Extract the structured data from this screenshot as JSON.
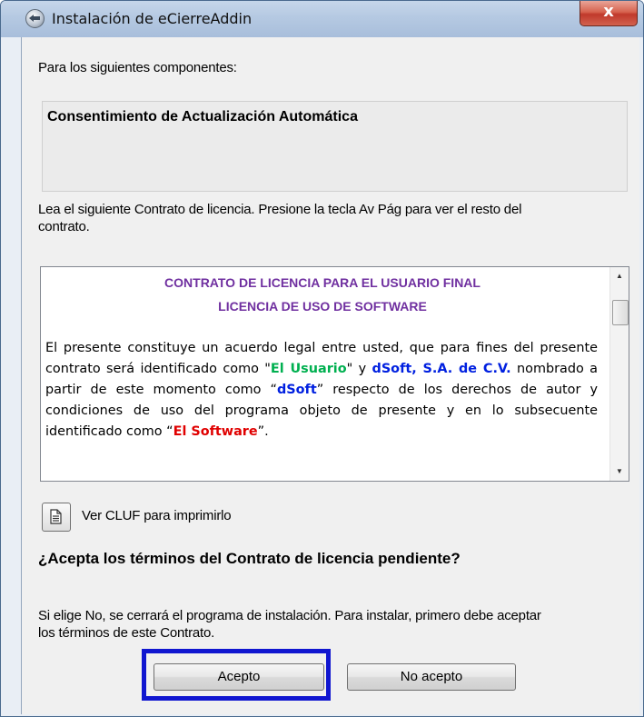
{
  "window": {
    "title": "Instalación de eCierreAddin",
    "close_label": "x"
  },
  "components_label": "Para los siguientes componentes:",
  "component_name": "Consentimiento de Actualización Automática",
  "instruction_line1": "Lea el siguiente Contrato de licencia. Presione la tecla Av Pág para ver el resto del",
  "instruction_line2": "contrato.",
  "license": {
    "heading1": "CONTRATO DE LICENCIA PARA EL USUARIO FINAL",
    "heading2": "LICENCIA DE USO DE SOFTWARE",
    "p1": "El presente constituye un acuerdo legal entre usted, que para fines del presente contrato será identificado como \"",
    "usuario": "El Usuario",
    "p2": "\" y ",
    "dsoft_company": "dSoft, S.A. de C.V.",
    "p3": " nombrado a partir de este momento como “",
    "dsoft": "dSoft",
    "p4": "” respecto de los derechos de autor y condiciones de uso del programa objeto de presente y en lo subsecuente identificado como “",
    "software": "El Software",
    "p5": "”."
  },
  "print_label": "Ver CLUF para imprimirlo",
  "question": "¿Acepta los términos del Contrato de licencia pendiente?",
  "warning_line1": "Si elige No, se cerrará el programa de instalación. Para instalar, primero debe aceptar",
  "warning_line2": "los términos de este Contrato.",
  "buttons": {
    "accept": "Acepto",
    "decline": "No acepto"
  },
  "colors": {
    "heading": "#7030a0",
    "usuario": "#00b050",
    "dsoft": "#0020e0",
    "software": "#e00000",
    "highlight": "#1016d0"
  },
  "icons": [
    "installer-app-icon",
    "close-icon",
    "scroll-up-icon",
    "scroll-down-icon",
    "document-icon"
  ]
}
